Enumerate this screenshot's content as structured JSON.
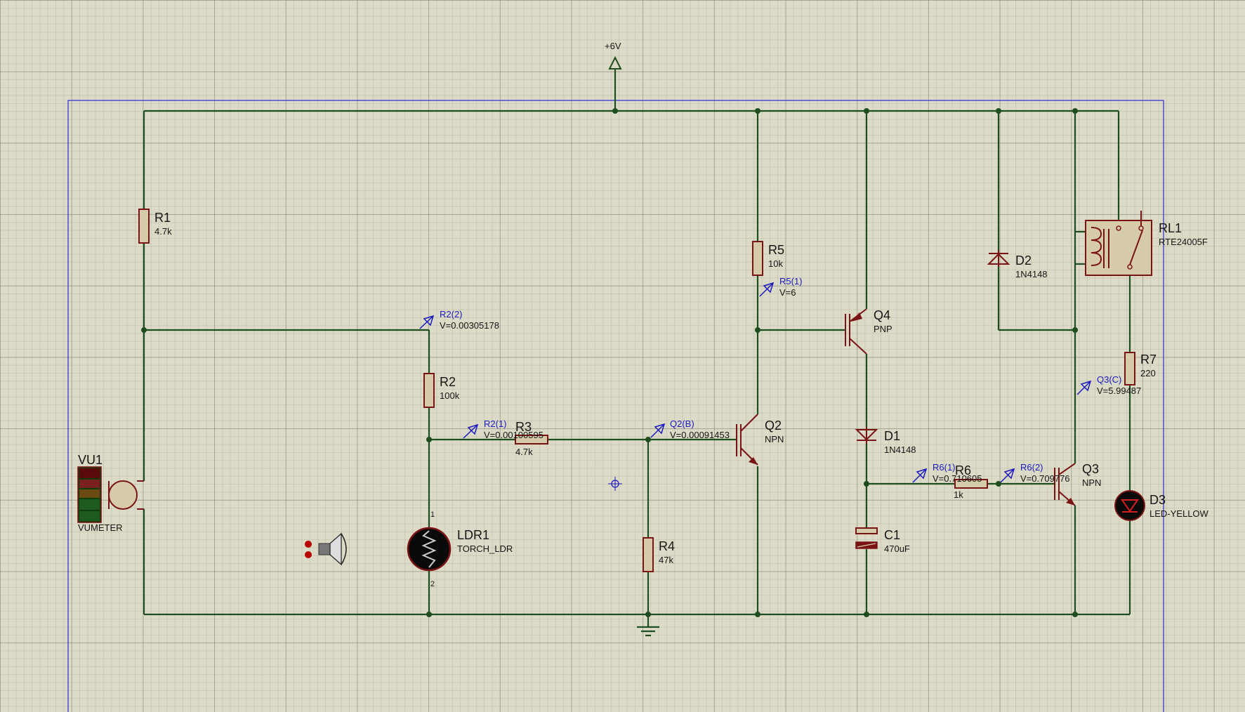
{
  "power": {
    "label": "+6V"
  },
  "components": {
    "R1": {
      "ref": "R1",
      "value": "4.7k"
    },
    "R2": {
      "ref": "R2",
      "value": "100k"
    },
    "R3": {
      "ref": "R3",
      "value": "4.7k"
    },
    "R4": {
      "ref": "R4",
      "value": "47k"
    },
    "R5": {
      "ref": "R5",
      "value": "10k"
    },
    "R6": {
      "ref": "R6",
      "value": "1k"
    },
    "R7": {
      "ref": "R7",
      "value": "220"
    },
    "Q2": {
      "ref": "Q2",
      "value": "NPN"
    },
    "Q3": {
      "ref": "Q3",
      "value": "NPN"
    },
    "Q4": {
      "ref": "Q4",
      "value": "PNP"
    },
    "D1": {
      "ref": "D1",
      "value": "1N4148"
    },
    "D2": {
      "ref": "D2",
      "value": "1N4148"
    },
    "D3": {
      "ref": "D3",
      "value": "LED-YELLOW"
    },
    "C1": {
      "ref": "C1",
      "value": "470uF"
    },
    "LDR1": {
      "ref": "LDR1",
      "value": "TORCH_LDR",
      "pin1": "1",
      "pin2": "2"
    },
    "RL1": {
      "ref": "RL1",
      "value": "RTE24005F"
    },
    "VU1": {
      "ref": "VU1",
      "value": "VUMETER"
    }
  },
  "probes": {
    "r2_2": {
      "name": "R2(2)",
      "value": "V=0.00305178"
    },
    "r2_1": {
      "name": "R2(1)",
      "value": "V=0.00100595"
    },
    "q2_b": {
      "name": "Q2(B)",
      "value": "V=0.00091453"
    },
    "r5_1": {
      "name": "R5(1)",
      "value": "V=6"
    },
    "r6_1": {
      "name": "R6(1)",
      "value": "V=0.710605"
    },
    "r6_2": {
      "name": "R6(2)",
      "value": "V=0.709776"
    },
    "q3_c": {
      "name": "Q3(C)",
      "value": "V=5.99487"
    }
  },
  "colors": {
    "wire": "#1e4d1e",
    "component": "#7a1414",
    "probe": "#1a1ac0",
    "border": "#2a2ad0",
    "background": "#dcdbc8"
  }
}
